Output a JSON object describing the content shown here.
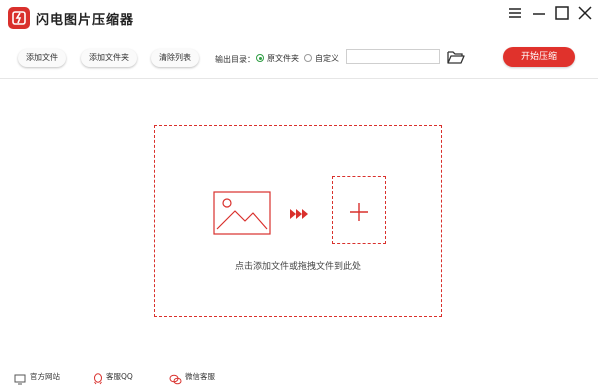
{
  "app": {
    "title": "闪电图片压缩器"
  },
  "toolbar": {
    "add_file_label": "添加文件",
    "add_folder_label": "添加文件夹",
    "clear_list_label": "清除列表",
    "output_dir_label": "输出目录：",
    "output_options": [
      "原文件夹",
      "自定义"
    ],
    "selected_option": "原文件夹",
    "path_value": "",
    "start_label": "开始压缩"
  },
  "dropzone": {
    "hint": "点击添加文件或拖拽文件到此处"
  },
  "footer": {
    "website_label": "官方网站",
    "qq_label": "客服QQ",
    "wechat_label": "微信客服"
  },
  "colors": {
    "accent": "#d9302c",
    "radio_selected": "#2f9e44"
  },
  "icons": [
    "app-logo-icon",
    "menu-icon",
    "minimize-icon",
    "maximize-icon",
    "close-icon",
    "folder-open-icon",
    "image-icon",
    "triple-arrow-icon",
    "plus-icon",
    "monitor-icon",
    "qq-icon",
    "wechat-icon"
  ]
}
